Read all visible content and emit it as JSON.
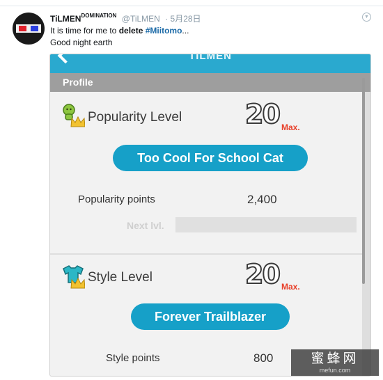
{
  "tweet": {
    "display_name": "TiLMEN",
    "display_name_sup": "DOMINATION",
    "handle": "@TiLMEN",
    "date": "· 5月28日",
    "text_prefix": "It is time for me to",
    "text_bold": "delete",
    "hashtag": "#Miitomo",
    "text_suffix": "...",
    "line2": "Good night earth",
    "more_icon": "chevron-down-icon"
  },
  "app": {
    "header_title": "TILMEN",
    "section": "Profile",
    "accent_color": "#16a0c8",
    "popularity": {
      "label": "Popularity Level",
      "level": "20",
      "max": "Max.",
      "title": "Too Cool For School Cat",
      "points_label": "Popularity points",
      "points_value": "2,400",
      "next_label": "Next lvl.",
      "icon": "popularity-icon"
    },
    "style": {
      "label": "Style Level",
      "level": "20",
      "max": "Max.",
      "title": "Forever Trailblazer",
      "points_label": "Style points",
      "points_value": "800",
      "icon": "style-icon"
    }
  },
  "watermark": {
    "text": "蜜蜂网",
    "site": "mefun.com"
  }
}
